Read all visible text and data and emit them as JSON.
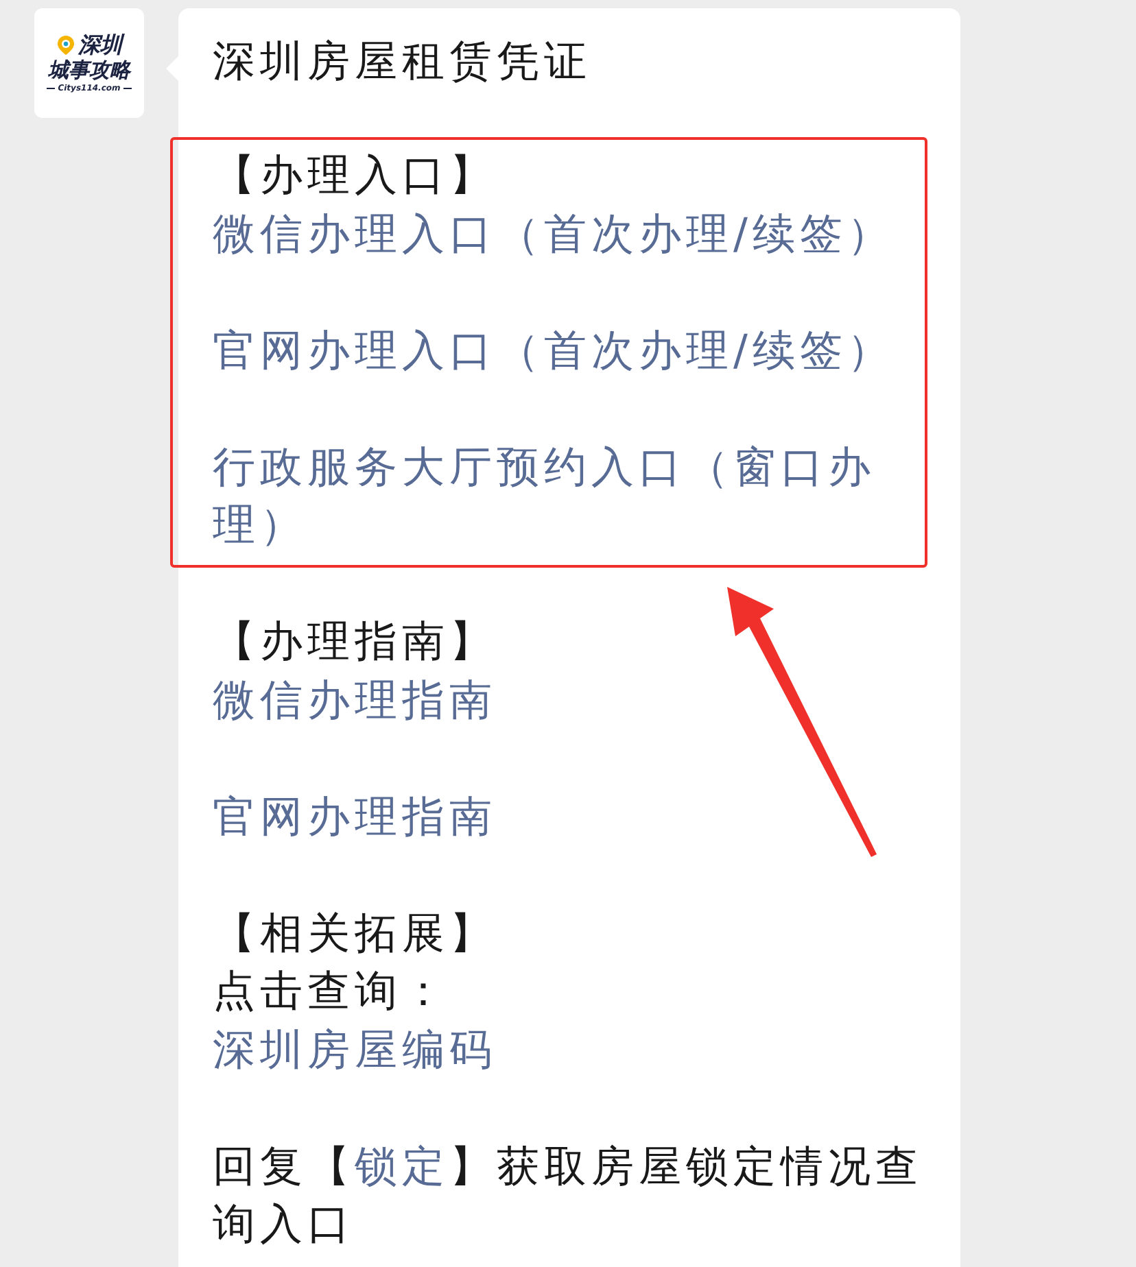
{
  "avatar": {
    "line_1": "深圳",
    "line_2": "城事攻略",
    "line_3": "Citys114.com"
  },
  "message": {
    "title": "深圳房屋租赁凭证",
    "sections": [
      {
        "highlighted": true,
        "items": [
          {
            "kind": "heading",
            "text": "【办理入口】"
          },
          {
            "kind": "link",
            "text": "微信办理入口（首次办理/续签）"
          },
          {
            "kind": "link",
            "text": "官网办理入口（首次办理/续签）"
          },
          {
            "kind": "link",
            "text": "行政服务大厅预约入口（窗口办理）"
          }
        ]
      },
      {
        "highlighted": false,
        "items": [
          {
            "kind": "heading",
            "text": "【办理指南】"
          },
          {
            "kind": "link",
            "text": "微信办理指南"
          },
          {
            "kind": "link",
            "text": "官网办理指南"
          }
        ]
      },
      {
        "highlighted": false,
        "items": [
          {
            "kind": "heading",
            "text": "【相关拓展】"
          },
          {
            "kind": "text",
            "text": "点击查询："
          },
          {
            "kind": "link",
            "text": "深圳房屋编码"
          }
        ]
      },
      {
        "highlighted": false,
        "items": [
          {
            "kind": "mixed",
            "parts": [
              {
                "kind": "text",
                "text": "回复【"
              },
              {
                "kind": "link",
                "text": "锁定"
              },
              {
                "kind": "text",
                "text": "】获取房屋锁定情况查询入口"
              }
            ]
          }
        ]
      }
    ]
  }
}
